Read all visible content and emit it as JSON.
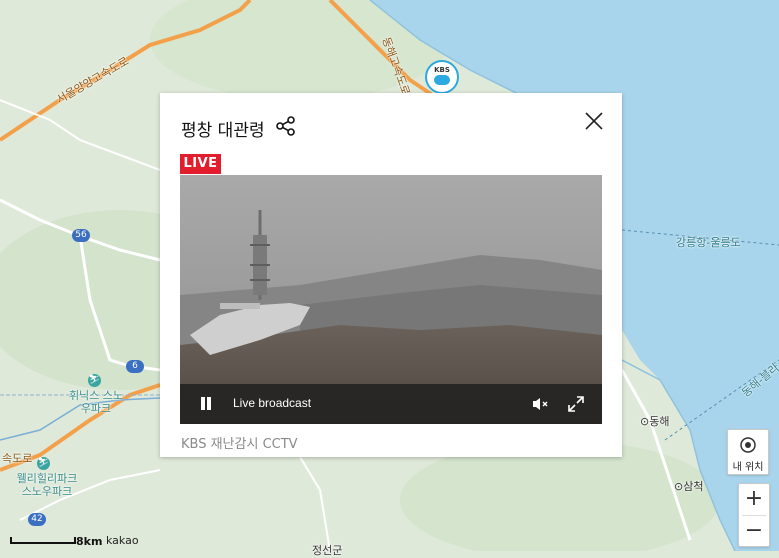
{
  "popup": {
    "title": "평창 대관령",
    "live_badge": "LIVE",
    "live_text": "Live broadcast",
    "source": "KBS 재난감시 CCTV"
  },
  "map": {
    "road_labels": [
      "서울양양고속도로",
      "동해고속도로",
      "속도로"
    ],
    "sea_route_labels": [
      "강릉항-울릉도",
      "동해-블라"
    ],
    "places": [
      "휘닉스 스노우파크",
      "웰리힐리파크 스노우파크",
      "동해",
      "삼척",
      "정선군"
    ],
    "route_numbers": [
      "56",
      "6",
      "42"
    ],
    "kbs_marker": "KBS",
    "scale": "8km",
    "attribution": "kakao",
    "locate_label": "내 위치",
    "zoom_in": "+",
    "zoom_out": "−"
  },
  "colors": {
    "sea": "#a8d5ec",
    "land": "#dfe9d9",
    "live_red": "#e21d2d",
    "highway": "#f3a04b"
  },
  "icons": [
    "share-icon",
    "close-icon",
    "pause-icon",
    "mute-icon",
    "fullscreen-icon",
    "locate-icon",
    "ski-icon",
    "kbs-marker-icon"
  ]
}
